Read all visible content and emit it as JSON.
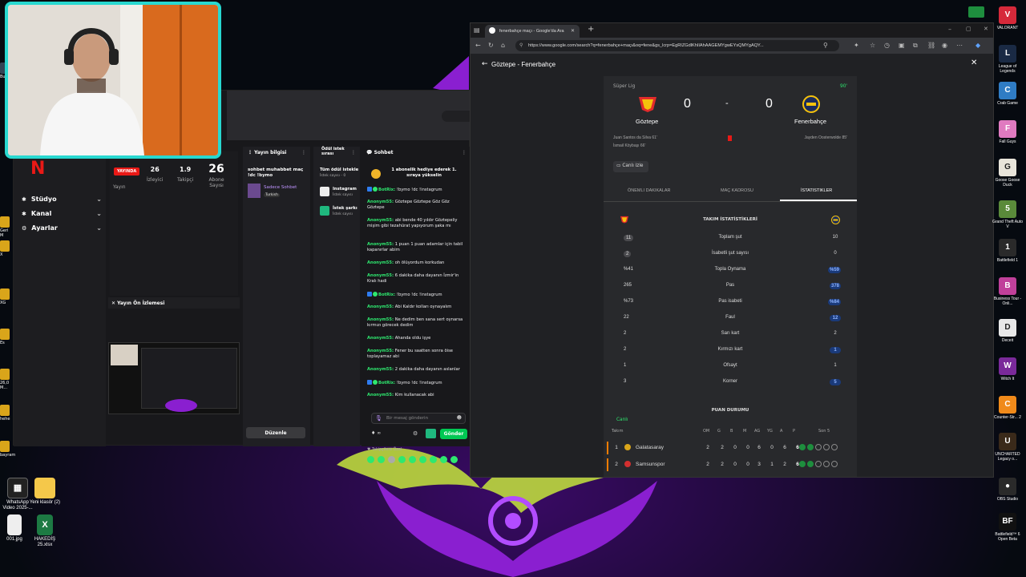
{
  "colors": {
    "accent_green": "#2ee86f",
    "live_red": "#e91916",
    "webcam_border": "#28d8d0",
    "wallpaper_purple": "#8a1fd0",
    "wallpaper_green": "#c6e63c",
    "highlight_blue": "#8fb4ff"
  },
  "desktop_icons_bottom": [
    {
      "label": "WhatsApp Video 2025-...",
      "icon": "video-file-icon"
    },
    {
      "label": "Yeni klasör (2)",
      "icon": "folder-icon"
    },
    {
      "label": "001.jpg",
      "icon": "image-file-icon"
    },
    {
      "label": "HAKEDİŞ 25.xlsx",
      "icon": "excel-file-icon"
    }
  ],
  "desktop_icons_left": [
    {
      "label": "Bu"
    },
    {
      "label": "Geri M"
    },
    {
      "label": "X"
    },
    {
      "label": "XG"
    },
    {
      "label": "Es"
    },
    {
      "label": "26,0 M..."
    },
    {
      "label": "hehe"
    },
    {
      "label": "bayram"
    }
  ],
  "dock_icons_right": [
    {
      "label": "VALORANT",
      "icon": "valorant-icon"
    },
    {
      "label": "League of Legends",
      "icon": "lol-icon"
    },
    {
      "label": "Crab Game",
      "icon": "crab-game-icon"
    },
    {
      "label": "Fall Guys",
      "icon": "fall-guys-icon"
    },
    {
      "label": "Goose Goose Duck",
      "icon": "goose-icon"
    },
    {
      "label": "Grand Theft Auto V",
      "icon": "gta-icon"
    },
    {
      "label": "Battlefield 1",
      "icon": "battlefield-icon"
    },
    {
      "label": "Business Tour - Onli...",
      "icon": "business-tour-icon"
    },
    {
      "label": "Deceit",
      "icon": "deceit-icon"
    },
    {
      "label": "Witch It",
      "icon": "witch-it-icon"
    },
    {
      "label": "Counter-Str... 2",
      "icon": "cs2-icon"
    },
    {
      "label": "UNCHARTED Legacy o...",
      "icon": "uncharted-icon"
    },
    {
      "label": "OBS Studio",
      "icon": "obs-icon"
    },
    {
      "label": "Battlefield™ 6 Open Beta",
      "icon": "bf6-icon"
    }
  ],
  "studio": {
    "sidebar": {
      "items": [
        {
          "label": "Stüdyo",
          "icon": "studio-icon"
        },
        {
          "label": "Kanal",
          "icon": "channel-icon"
        },
        {
          "label": "Ayarlar",
          "icon": "settings-icon"
        }
      ]
    },
    "stats": {
      "live_badge": "YAYINDA",
      "stream_label": "Yayın",
      "viewers_value": "26",
      "viewers_label": "İzleyici",
      "followers_value": "1.9",
      "followers_label": "Takipçi",
      "subs_value": "26",
      "subs_label": "Abone Sayısı"
    },
    "preview_title": "Yayın Ön İzlemesi",
    "stream_info": {
      "title": "Yayın bilgisi",
      "stream_title": "sohbet muhabbet maç !dc !bymo",
      "category": "Sadece Sohbet",
      "language": "Turkish"
    },
    "rewards": {
      "title": "Ödül istek sırası",
      "all_requests": "Tüm ödül istekle",
      "request_count": "İstek sayısı - 0",
      "item1_title": "Instagram",
      "item1_sub": "İstek sayısı",
      "item2_title": "İstek şarkı",
      "item2_sub": "İstek sayısı",
      "edit_button": "Düzenle"
    },
    "chat": {
      "title": "Sohbet",
      "banner": "1 abonelik hediye ederek 1. sıraya yükselin",
      "messages": [
        {
          "user": "BotRix:",
          "text": "!bymo !dc !instagrum",
          "bot": true
        },
        {
          "user": "Anonym55:",
          "text": "Göztepe Göztepe Göz Göz Göztepe"
        },
        {
          "user": "Anonym55:",
          "text": "abi bende 40 yıldır Göztepeliy mişim gibi tezahürat yapıyorum şaka mı"
        },
        {
          "user": "Anonym55:",
          "text": "1 puan 1 puan adamlar için tabil kapanırlar abim"
        },
        {
          "user": "Anonym55:",
          "text": "oh ölüyordum korkudan"
        },
        {
          "user": "Anonym55:",
          "text": "6 dakika daha dayanın İzmir'in Kralı hadi"
        },
        {
          "user": "BotRix:",
          "text": "!bymo !dc !instagrum",
          "bot": true
        },
        {
          "user": "Anonym55:",
          "text": "Abi Kaldır kolları oynayalım"
        },
        {
          "user": "Anonym55:",
          "text": "Ne dedim ben sana sert oynarsa kırmızı görecek dedim"
        },
        {
          "user": "Anonym55:",
          "text": "Ahanda oldu işye"
        },
        {
          "user": "Anonym55:",
          "text": "Fener bu saatten sonra öise toplayamaz abi"
        },
        {
          "user": "Anonym55:",
          "text": "2 dakika daha dayanın aslanlar"
        },
        {
          "user": "BotRix:",
          "text": "!bymo !dc !instagrum",
          "bot": true
        },
        {
          "user": "Anonym55:",
          "text": "Kim kullanacak abi"
        }
      ],
      "followers_only": "Takipçilere Özel",
      "input_placeholder": "Bir mesaj gönderin",
      "points": "∞",
      "send_button": "Gönder"
    }
  },
  "browser": {
    "tab_title": "fenerbahçe maçı - Google'da Ara",
    "url": "https://www.google.com/search?q=fenerbahçe+maçı&oq=fene&gs_lcrp=EgRIZGdlKhIIAhAAGEMYgwEYsQMYgAQY...",
    "match_header": "Göztepe - Fenerbahçe",
    "league": "Süper Lig",
    "minute": "90'",
    "home_team": "Göztepe",
    "away_team": "Fenerbahçe",
    "home_score": "0",
    "away_score": "0",
    "score_sep": "-",
    "home_events": [
      "Juan Santos da Silva 61'",
      "İsmail Köybaşı 66'"
    ],
    "away_events": [
      "Jayden Oosterwolde 85'"
    ],
    "watch_live": "Canlı izle",
    "tabs": [
      "Önemli dakikalar",
      "Maç kadrosu",
      "İstatistikler"
    ],
    "team_stats_title": "TAKIM İSTATİSTİKLERİ",
    "stats": [
      {
        "label": "Toplam şut",
        "home": "11",
        "away": "10",
        "home_hi": true,
        "away_hi": false
      },
      {
        "label": "İsabetli şut sayısı",
        "home": "2",
        "away": "0",
        "home_hi": true,
        "away_hi": false
      },
      {
        "label": "Topla Oynama",
        "home": "%41",
        "away": "%59",
        "home_hi": false,
        "away_hi": true
      },
      {
        "label": "Pas",
        "home": "265",
        "away": "378",
        "home_hi": false,
        "away_hi": true
      },
      {
        "label": "Pas isabeti",
        "home": "%73",
        "away": "%84",
        "home_hi": false,
        "away_hi": true
      },
      {
        "label": "Faul",
        "home": "22",
        "away": "12",
        "home_hi": false,
        "away_hi": true
      },
      {
        "label": "Sarı kart",
        "home": "2",
        "away": "2",
        "home_hi": false,
        "away_hi": false
      },
      {
        "label": "Kırmızı kart",
        "home": "2",
        "away": "1",
        "home_hi": false,
        "away_hi": true
      },
      {
        "label": "Ofsayt",
        "home": "1",
        "away": "1",
        "home_hi": false,
        "away_hi": false
      },
      {
        "label": "Korner",
        "home": "3",
        "away": "5",
        "home_hi": false,
        "away_hi": true
      }
    ],
    "standings_title": "PUAN DURUMU",
    "standings_live": "Canlı",
    "standings_headers": [
      "Takım",
      "OM",
      "G",
      "B",
      "M",
      "AG",
      "YG",
      "A",
      "P",
      "Son 5"
    ],
    "standings": [
      {
        "rank": "1",
        "team": "Galatasaray",
        "om": "2",
        "g": "2",
        "b": "0",
        "m": "0",
        "ag": "6",
        "yg": "0",
        "a": "6",
        "p": "6",
        "wins": 2
      },
      {
        "rank": "2",
        "team": "Samsunspor",
        "om": "2",
        "g": "2",
        "b": "0",
        "m": "0",
        "ag": "3",
        "yg": "1",
        "a": "2",
        "p": "6",
        "wins": 2
      }
    ]
  }
}
